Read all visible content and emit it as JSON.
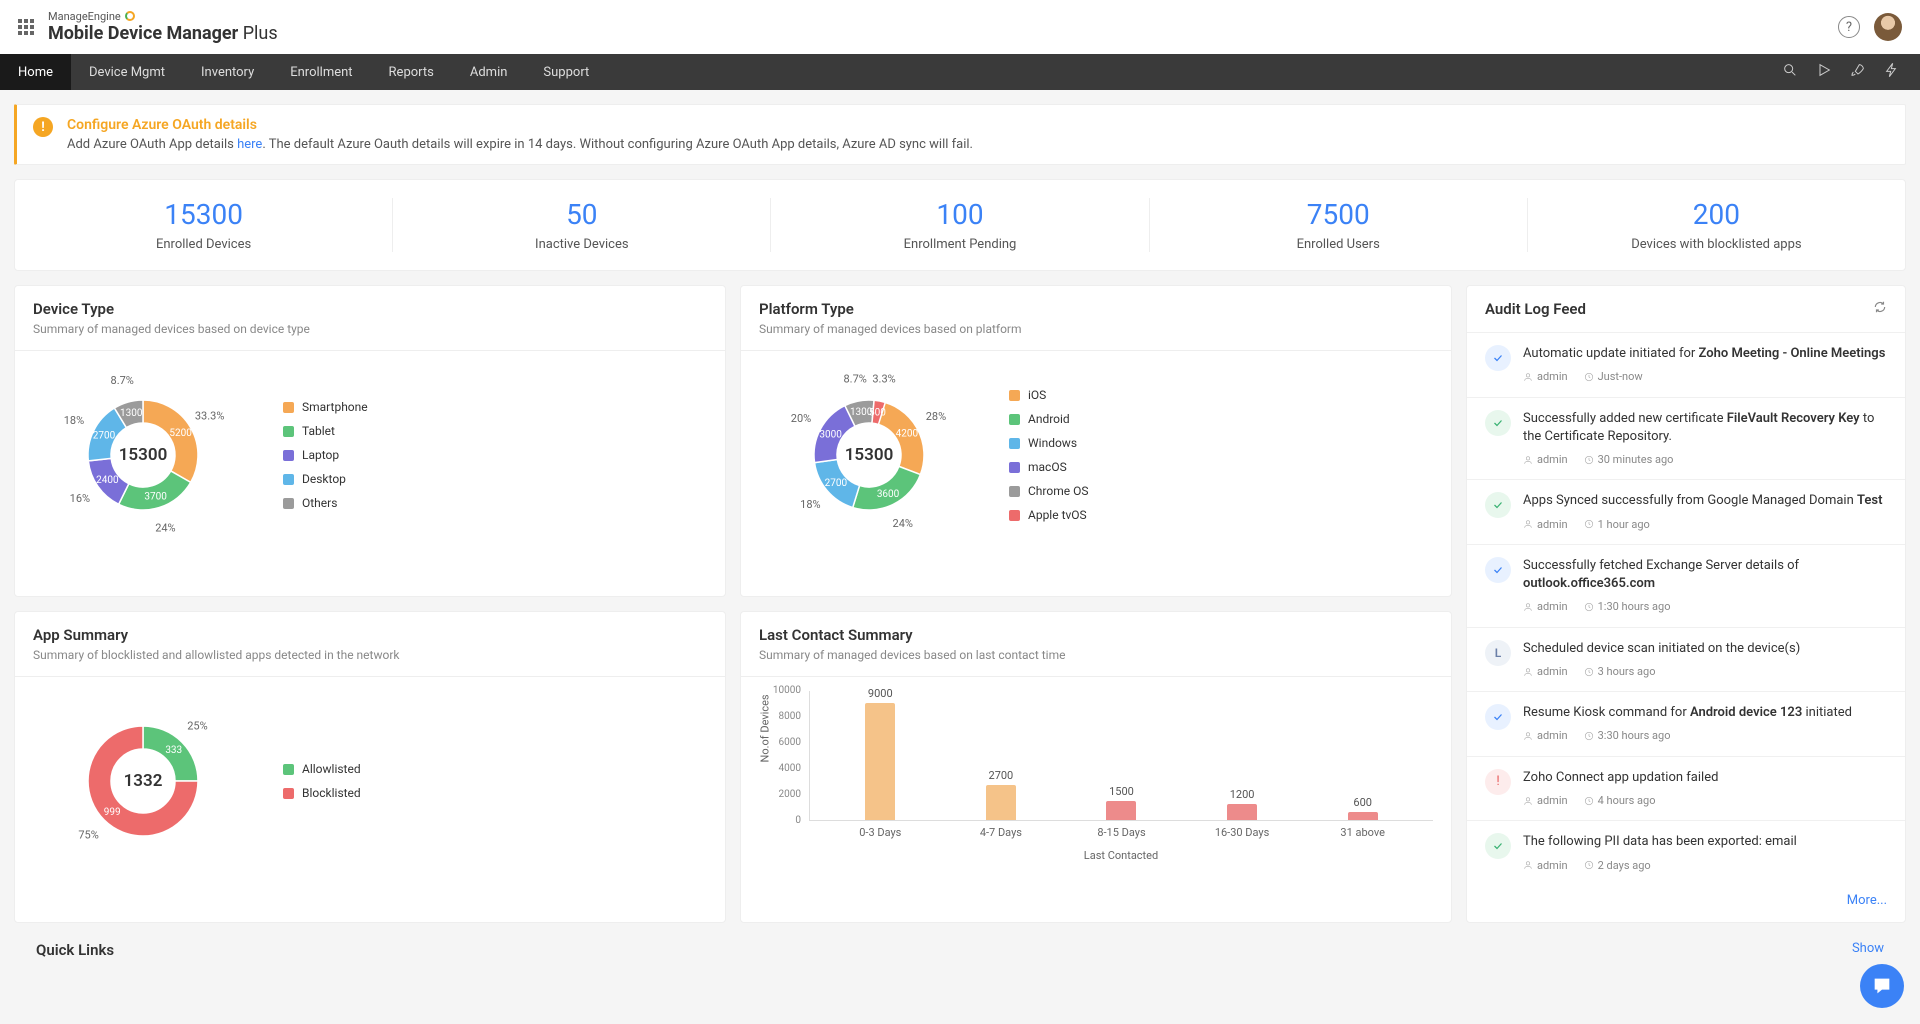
{
  "brand": {
    "company": "ManageEngine",
    "product_bold": "Mobile Device Manager",
    "product_light": " Plus"
  },
  "nav": {
    "items": [
      "Home",
      "Device Mgmt",
      "Inventory",
      "Enrollment",
      "Reports",
      "Admin",
      "Support"
    ],
    "active": 0
  },
  "alert": {
    "title": "Configure Azure OAuth details",
    "body_pre": "Add Azure OAuth App details ",
    "body_link": "here",
    "body_post": ". The default Azure Oauth details will expire in 14 days. Without configuring Azure OAuth App details, Azure AD sync will fail."
  },
  "kpis": [
    {
      "val": "15300",
      "lbl": "Enrolled Devices"
    },
    {
      "val": "50",
      "lbl": "Inactive Devices"
    },
    {
      "val": "100",
      "lbl": "Enrollment Pending"
    },
    {
      "val": "7500",
      "lbl": "Enrolled Users"
    },
    {
      "val": "200",
      "lbl": "Devices with blocklisted apps"
    }
  ],
  "device_type_card": {
    "title": "Device Type",
    "sub": "Summary of managed devices based on device type",
    "center": "15300"
  },
  "platform_card": {
    "title": "Platform Type",
    "sub": "Summary of managed devices based on platform",
    "center": "15300"
  },
  "app_card": {
    "title": "App Summary",
    "sub": "Summary of blocklisted and allowlisted apps detected in the network",
    "center": "1332"
  },
  "contact_card": {
    "title": "Last Contact Summary",
    "sub": "Summary of managed devices based on last contact time",
    "ylabel": "No.of Devices",
    "xlabel": "Last Contacted"
  },
  "audit": {
    "title": "Audit Log Feed",
    "more": "More...",
    "items": [
      {
        "icon": "check-blue",
        "html": "Automatic update initiated for <strong>Zoho Meeting - Online Meetings</strong>",
        "user": "admin",
        "time": "Just-now"
      },
      {
        "icon": "check-green",
        "html": "Successfully added new certificate <strong>FileVault Recovery Key</strong> to the Certificate Repository.",
        "user": "admin",
        "time": "30 minutes ago"
      },
      {
        "icon": "check-green",
        "html": "Apps Synced successfully from Google Managed Domain <strong>Test</strong>",
        "user": "admin",
        "time": "1 hour ago"
      },
      {
        "icon": "check-blue",
        "html": "Successfully fetched Exchange Server details of <strong>outlook.office365.com</strong>",
        "user": "admin",
        "time": "1:30 hours ago"
      },
      {
        "icon": "letter",
        "letter": "L",
        "html": "Scheduled device scan initiated on the device(s)",
        "user": "admin",
        "time": "3 hours ago"
      },
      {
        "icon": "check-blue",
        "html": "Resume Kiosk command for <strong>Android device 123</strong> initiated",
        "user": "admin",
        "time": "3:30 hours ago"
      },
      {
        "icon": "alert-red",
        "html": "Zoho Connect app updation failed",
        "user": "admin",
        "time": "4 hours ago"
      },
      {
        "icon": "check-green",
        "html": "The following PII data has been exported: email",
        "user": "admin",
        "time": "2 days ago"
      }
    ]
  },
  "quicklinks": {
    "title": "Quick Links",
    "show": "Show"
  },
  "chart_data": [
    {
      "id": "device_type",
      "type": "pie",
      "title": "Device Type",
      "total": 15300,
      "series": [
        {
          "name": "Smartphone",
          "value": 5200,
          "pct": 33.3,
          "color": "#f5a855"
        },
        {
          "name": "Tablet",
          "value": 3700,
          "pct": 24,
          "color": "#5cc47a"
        },
        {
          "name": "Laptop",
          "value": 2400,
          "pct": 16,
          "color": "#7a6fd8"
        },
        {
          "name": "Desktop",
          "value": 2700,
          "pct": 18,
          "color": "#5fb6e8"
        },
        {
          "name": "Others",
          "value": 1300,
          "pct": 8.7,
          "color": "#9b9b9b"
        }
      ]
    },
    {
      "id": "platform",
      "type": "pie",
      "title": "Platform Type",
      "total": 15300,
      "series": [
        {
          "name": "iOS",
          "value": 4200,
          "pct": 28,
          "color": "#f5a855"
        },
        {
          "name": "Android",
          "value": 3600,
          "pct": 24,
          "color": "#5cc47a"
        },
        {
          "name": "Windows",
          "value": 2700,
          "pct": 18,
          "color": "#5fb6e8"
        },
        {
          "name": "macOS",
          "value": 3000,
          "pct": 20,
          "color": "#7a6fd8"
        },
        {
          "name": "Chrome OS",
          "value": 1300,
          "pct": 8.7,
          "color": "#9b9b9b"
        },
        {
          "name": "Apple tvOS",
          "value": 500,
          "pct": 3.3,
          "color": "#ed6b6b"
        }
      ]
    },
    {
      "id": "app_summary",
      "type": "pie",
      "title": "App Summary",
      "total": 1332,
      "series": [
        {
          "name": "Allowlisted",
          "value": 333,
          "pct": 25,
          "color": "#5cc47a"
        },
        {
          "name": "Blocklisted",
          "value": 999,
          "pct": 75,
          "color": "#ed6b6b"
        }
      ]
    },
    {
      "id": "last_contact",
      "type": "bar",
      "title": "Last Contact Summary",
      "xlabel": "Last Contacted",
      "ylabel": "No.of Devices",
      "ylim": [
        0,
        10000
      ],
      "yticks": [
        0,
        2000,
        4000,
        6000,
        8000,
        10000
      ],
      "categories": [
        "0-3 Days",
        "4-7 Days",
        "8-15 Days",
        "16-30 Days",
        "31 above"
      ],
      "values": [
        9000,
        2700,
        1500,
        1200,
        600
      ],
      "colors": [
        "#f5c389",
        "#f5c389",
        "#ed8b8b",
        "#ed8b8b",
        "#ed8b8b"
      ]
    }
  ]
}
